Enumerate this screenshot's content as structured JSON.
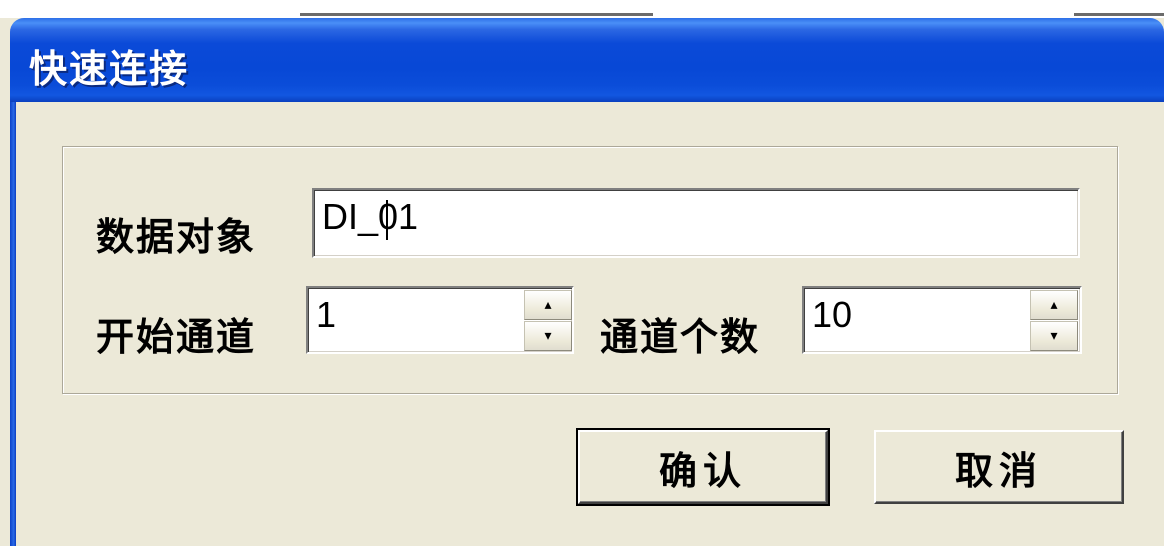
{
  "dialog": {
    "title": "快速连接",
    "fields": {
      "data_object": {
        "label": "数据对象",
        "value": "DI_01"
      },
      "start_channel": {
        "label": "开始通道",
        "value": "1"
      },
      "channel_count": {
        "label": "通道个数",
        "value": "10"
      }
    },
    "spin": {
      "up_glyph": "▴",
      "down_glyph": "▾"
    },
    "buttons": {
      "ok": "确认",
      "cancel": "取消"
    }
  },
  "colors": {
    "title_bar": "#0848d6",
    "dialog_face": "#ece9d8",
    "field_bg": "#ffffff"
  }
}
